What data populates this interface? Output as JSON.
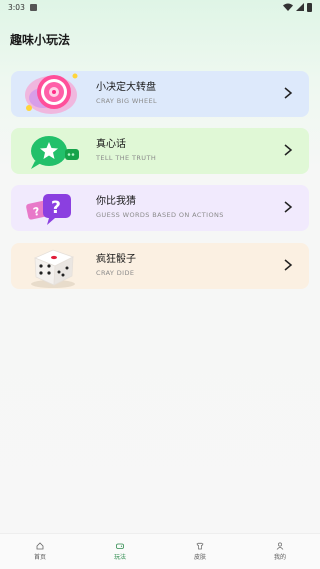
{
  "status_bar": {
    "time": "3:03",
    "icons": [
      "notification-icon",
      "wifi-icon",
      "signal-icon",
      "battery-icon"
    ]
  },
  "page": {
    "title": "趣味小玩法"
  },
  "cards": [
    {
      "title": "小决定大转盘",
      "subtitle": "CRAY BIG WHEEL",
      "icon": "wheel-icon",
      "color": "#dde9fb"
    },
    {
      "title": "真心话",
      "subtitle": "TELL THE TRUTH",
      "icon": "chat-bubble-icon",
      "color": "#e0f8d6"
    },
    {
      "title": "你比我猜",
      "subtitle": "GUESS WORDS BASED ON ACTIONS",
      "icon": "question-bubble-icon",
      "color": "#f1eafd"
    },
    {
      "title": "疯狂骰子",
      "subtitle": "CRAY DIDE",
      "icon": "dice-icon",
      "color": "#fbf0e2"
    }
  ],
  "tab_bar": {
    "tabs": [
      {
        "label": "首页",
        "icon": "home-icon"
      },
      {
        "label": "玩法",
        "icon": "gamepad-icon",
        "active": true
      },
      {
        "label": "皮肤",
        "icon": "skin-icon"
      },
      {
        "label": "我的",
        "icon": "user-icon"
      }
    ]
  },
  "colors": {
    "accent": "#2e8b4e"
  }
}
